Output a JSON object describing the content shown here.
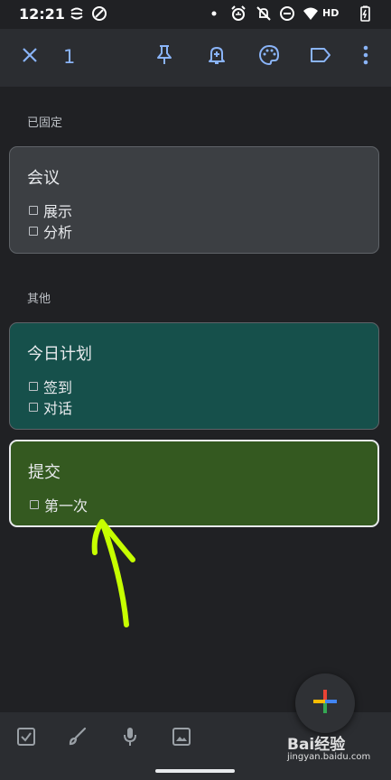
{
  "status_bar": {
    "time": "12:21",
    "network": "HD",
    "icons": [
      "sync-icon",
      "circle-slash-icon",
      "dot-icon",
      "alarm-icon",
      "bell-off-icon",
      "do-not-disturb-icon",
      "wifi-icon",
      "battery-icon"
    ]
  },
  "toolbar": {
    "selected_count": "1",
    "icons": [
      "close-icon",
      "pin-icon",
      "reminder-bell-icon",
      "palette-icon",
      "label-icon",
      "more-vert-icon"
    ],
    "accent_color": "#8ab4f8"
  },
  "sections": {
    "pinned_label": "已固定",
    "others_label": "其他"
  },
  "notes": {
    "pinned": {
      "title": "会议",
      "items": [
        "展示",
        "分析"
      ],
      "color": "#3c3f43"
    },
    "today": {
      "title": "今日计划",
      "items": [
        "签到",
        "对话"
      ],
      "color": "#16504b"
    },
    "submit": {
      "title": "提交",
      "items": [
        "第一次"
      ],
      "color": "#345920",
      "selected": true
    }
  },
  "bottom_bar": {
    "icons": [
      "checkbox-icon",
      "brush-icon",
      "mic-icon",
      "image-icon"
    ]
  },
  "fab": {
    "icon": "add-icon"
  },
  "watermark": {
    "main": "Bai经验",
    "sub": "jingyan.baidu.com"
  },
  "annotation": {
    "icon": "arrow-icon",
    "color": "#c6ff00"
  }
}
